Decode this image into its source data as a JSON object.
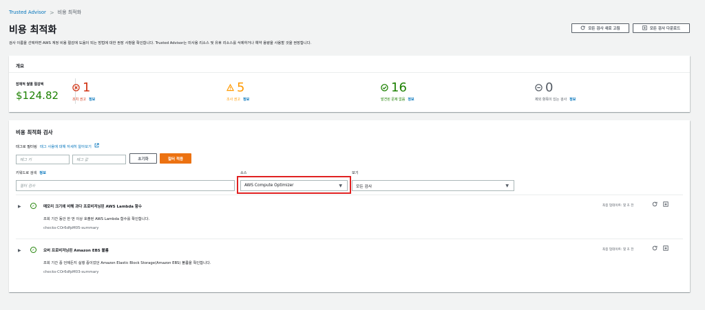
{
  "breadcrumb": {
    "root": "Trusted Advisor",
    "separator": ">",
    "current": "비용 최적화"
  },
  "header": {
    "title": "비용 최적화",
    "description": "검사 이름을 선택하면 AWS 계정 비용 절감에 도움이 되는 방법에 대한 권장 사항을 확인합니다. Trusted Advisor는 미사용 리소스 및 유휴 리소스를 삭제하거나 예약 용량을 사용할 것을 권장합니다.",
    "refresh_all_label": "모든 검사 새로 고침",
    "download_all_label": "모든 검사 다운로드"
  },
  "overview": {
    "title": "개요",
    "savings_label": "잠재적 월별 절감액",
    "savings_value": "$124.82",
    "stats": {
      "action": {
        "count": "1",
        "label": "조치 권고",
        "info": "정보"
      },
      "investigate": {
        "count": "5",
        "label": "조사 권고",
        "info": "정보"
      },
      "ok": {
        "count": "16",
        "label": "발견된 문제 없음",
        "info": "정보"
      },
      "excluded": {
        "count": "0",
        "label": "제외 항목이 있는 검사",
        "info": "정보"
      }
    }
  },
  "checks": {
    "title": "비용 최적화 검사",
    "tag_filter_label": "태그로 필터링",
    "tag_filter_link": "태그 사용에 대해 자세히 알아보기",
    "tag_key_placeholder": "태그 키",
    "tag_value_placeholder": "태그 값",
    "reset_label": "초기화",
    "apply_label": "필터 적용",
    "keyword_label": "키워드로 검색",
    "keyword_info": "정보",
    "keyword_placeholder": "필터 검사",
    "source_label": "소스",
    "source_value": "AWS Compute Optimizer",
    "view_label": "보기",
    "view_value": "모든 검사",
    "items": [
      {
        "name": "메모리 크기에 비해 과다 프로비저닝된 AWS Lambda 함수",
        "description": "조회 기간 동안 한 번 이상 호출된 AWS Lambda 함수를 확인합니다.",
        "id": "checks-COr6dfpM05-summary",
        "updated": "최종 업데이트: 몇 초 전"
      },
      {
        "name": "오버 프로비저닝된 Amazon EBS 볼륨",
        "description": "조회 기간 중 언제든지 실행 중이었던 Amazon Elastic Block Storage(Amazon EBS) 볼륨을 확인합니다.",
        "id": "checks-COr6dfpM03-summary",
        "updated": "최종 업데이트: 몇 초 전"
      }
    ]
  },
  "colors": {
    "link": "#0073bb",
    "action": "#d13212",
    "investigate": "#ff9900",
    "ok": "#1d8102",
    "primary_button": "#ec7211",
    "highlight": "#e02020"
  },
  "icons": {
    "refresh": "refresh-icon",
    "download": "download-icon",
    "action": "x-circle-icon",
    "investigate": "warning-triangle-icon",
    "ok": "check-circle-icon",
    "excluded": "minus-circle-icon",
    "external": "external-link-icon",
    "caret": "caret-down-icon",
    "expand": "caret-right-icon"
  }
}
